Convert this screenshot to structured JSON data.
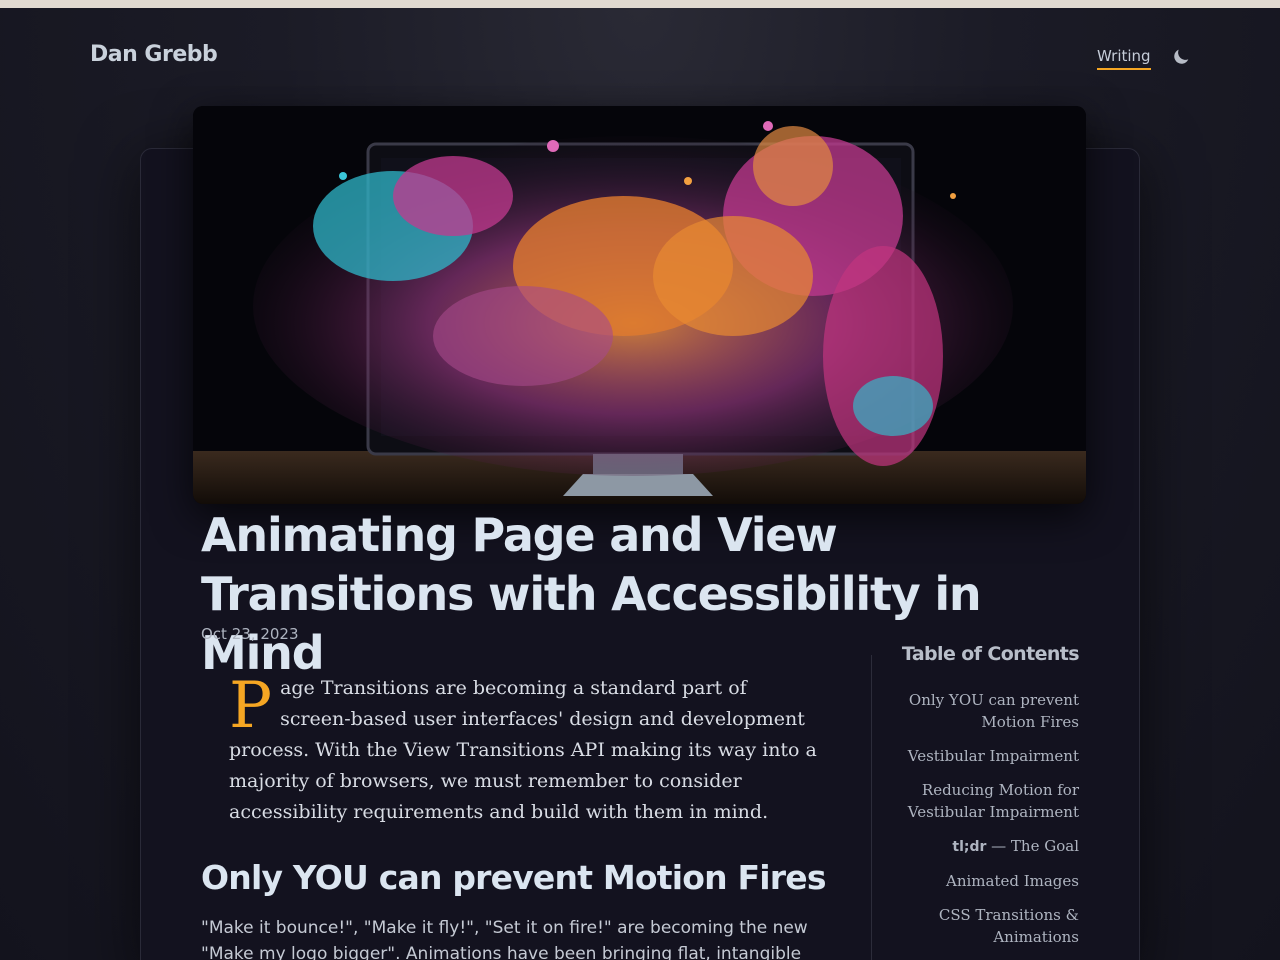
{
  "header": {
    "brand": "Dan Grebb",
    "nav": [
      {
        "label": "Writing"
      }
    ],
    "theme_toggle_icon": "moon-icon"
  },
  "article": {
    "hero_image_alt": "Colorful paint explosion bursting out of a computer monitor",
    "title": "Animating Page and View Transitions with Accessibility in Mind",
    "date": "Oct 23, 2023",
    "intro_dropcap": "P",
    "intro_rest": "age Transitions are becoming a standard part of screen-based user interfaces' design and development process. With the View Transitions API making its way into a majority of browsers, we must remember to consider accessibility requirements and build with them in mind.",
    "section_heading": "Only YOU can prevent Motion Fires",
    "section_body": "\"Make it bounce!\", \"Make it fly!\", \"Set it on fire!\" are becoming the new \"Make my logo bigger\". Animations have been bringing flat, intangible user"
  },
  "toc": {
    "title": "Table of Contents",
    "items": [
      {
        "label": "Only YOU can prevent Motion Fires"
      },
      {
        "label": "Vestibular Impairment"
      },
      {
        "label": "Reducing Motion for Vestibular Impairment"
      },
      {
        "code": "tl;dr",
        "label": " — The Goal"
      },
      {
        "label": "Animated Images"
      },
      {
        "label": "CSS Transitions & Animations"
      }
    ]
  },
  "colors": {
    "accent": "#f5a623",
    "background": "#13121f",
    "heading": "#dbe5f0"
  }
}
